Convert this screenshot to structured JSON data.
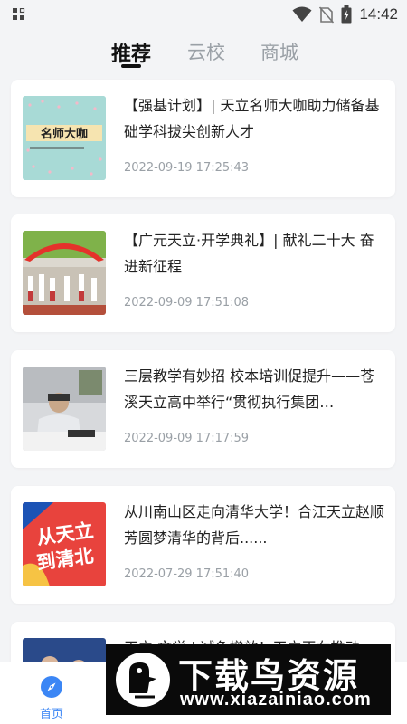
{
  "status_bar": {
    "time": "14:42",
    "icons": [
      "grid-icon",
      "wifi-icon",
      "no-sim-icon",
      "battery-icon"
    ]
  },
  "tabs": [
    {
      "label": "推荐",
      "active": true
    },
    {
      "label": "云校",
      "active": false
    },
    {
      "label": "商城",
      "active": false
    }
  ],
  "articles": [
    {
      "title": "【强基计划】| 天立名师大咖助力储备基础学科拔尖创新人才",
      "date": "2022-09-19 17:25:43",
      "thumb_text": "名师大咖"
    },
    {
      "title": "【广元天立·开学典礼】| 献礼二十大 奋进新征程",
      "date": "2022-09-09 17:51:08"
    },
    {
      "title": "三层教学有妙招  校本培训促提升——苍溪天立高中举行“贯彻执行集团…",
      "date": "2022-09-09 17:17:59"
    },
    {
      "title": "从川南山区走向清华大学！合江天立赵顺芳圆梦清华的背后......",
      "date": "2022-07-29 17:51:40",
      "thumb_text_1": "从天立",
      "thumb_text_2": "到清北"
    },
    {
      "title": "天立·文学 | 减负增效！天立正在推动",
      "date": ""
    }
  ],
  "bottom_nav": {
    "home_label": "首页"
  },
  "watermark": {
    "title": "下载鸟资源",
    "url": "www.xiazainiao.com"
  },
  "colors": {
    "accent": "#3b86f5",
    "background": "#f3f4f6",
    "date_text": "#9aa0a6"
  }
}
